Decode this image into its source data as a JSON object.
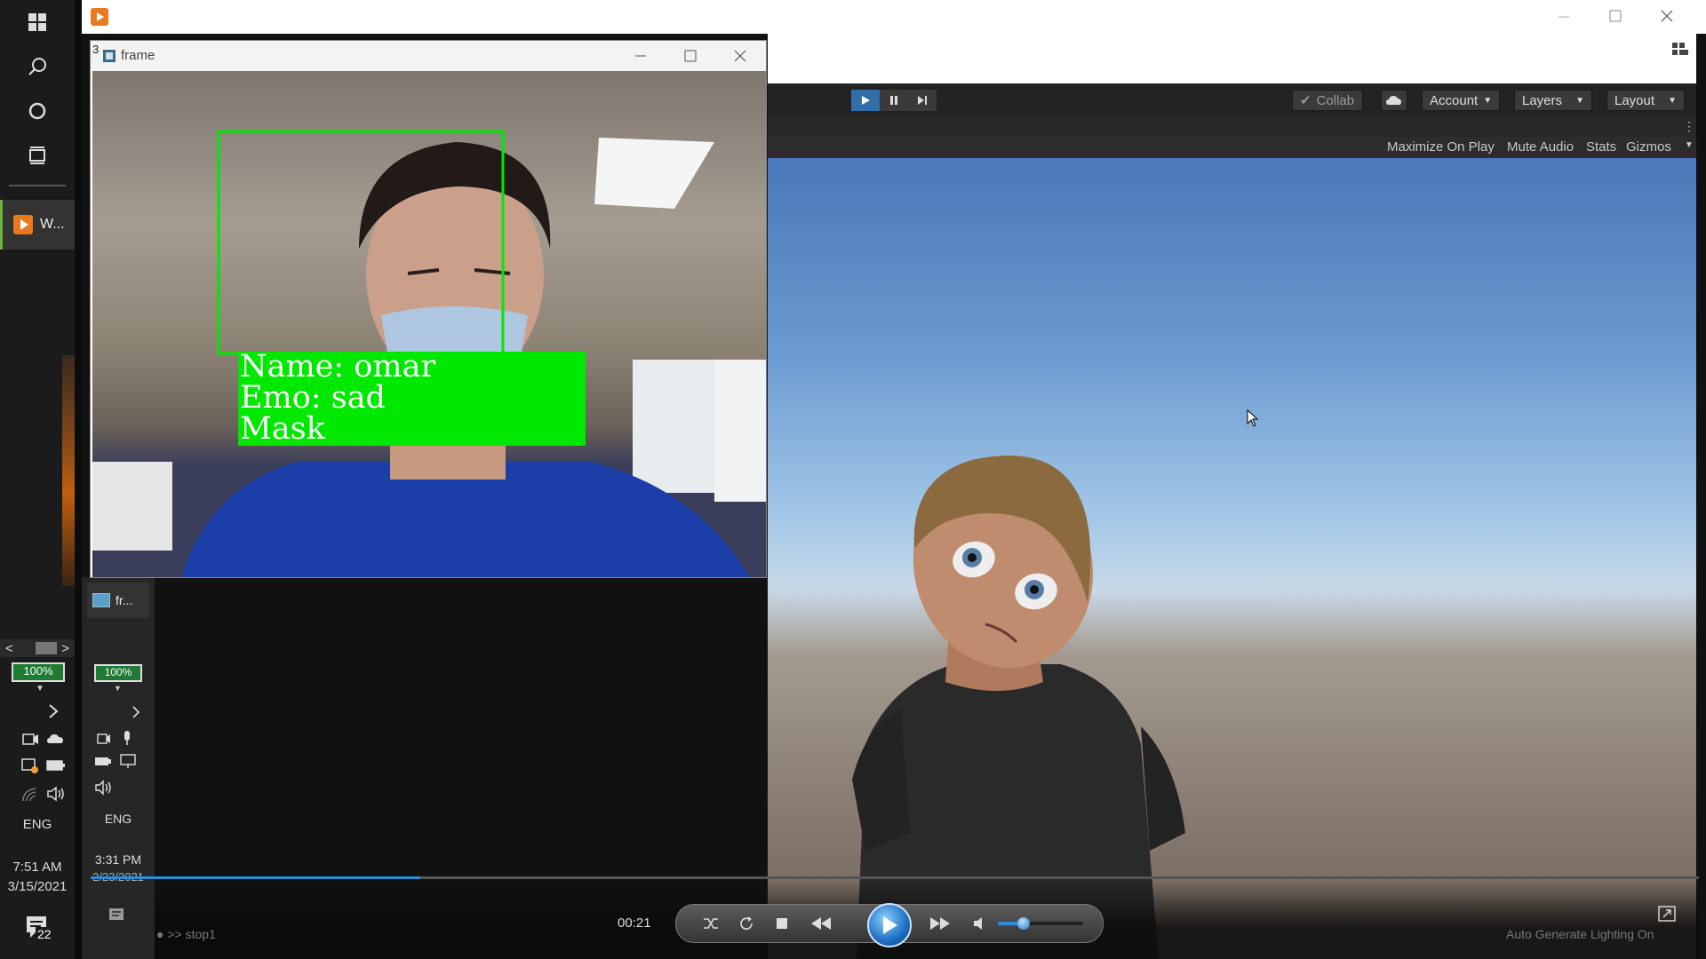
{
  "taskbar": {
    "app_label": "W...",
    "scroll_left": "<",
    "scroll_right": ">",
    "battery": "100%",
    "language": "ENG",
    "time": "7:51 AM",
    "date": "3/15/2021",
    "notifications": "22"
  },
  "inner_taskbar": {
    "app_label": "fr...",
    "battery": "100%",
    "language": "ENG",
    "time": "3:31 PM",
    "date": "2/23/2021"
  },
  "frame_window": {
    "title": "frame",
    "index_label": "3",
    "detection": {
      "name_line": "Name: omar",
      "emo_line": "Emo: sad",
      "mask_line": "Mask"
    }
  },
  "unity": {
    "collab": "Collab",
    "account": "Account",
    "layers": "Layers",
    "layout": "Layout",
    "game_view": [
      "Maximize On Play",
      "Mute Audio",
      "Stats",
      "Gizmos"
    ],
    "console_text": ">> stop1",
    "status_right": "Auto Generate Lighting On"
  },
  "player": {
    "elapsed": "00:21",
    "progress_fraction": 0.205,
    "volume_fraction": 0.3
  },
  "colors": {
    "detection_box": "#00e800",
    "progress": "#2d8cdc",
    "battery": "#1f7a33"
  }
}
